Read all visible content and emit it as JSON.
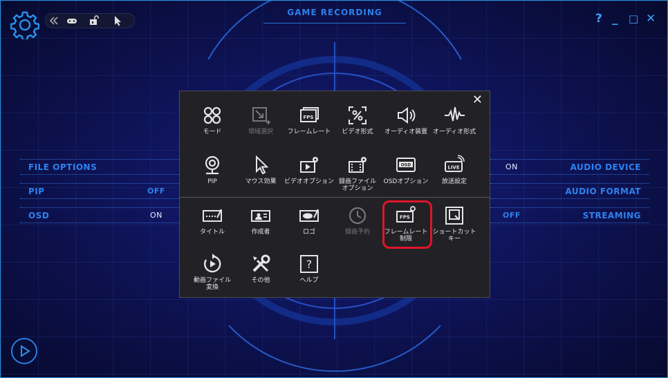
{
  "window": {
    "title": "GAME RECORDING",
    "help": "?",
    "minimize": "_",
    "maximize": "□",
    "close": "✕"
  },
  "left_panel": {
    "rows": [
      {
        "label": "FILE OPTIONS",
        "value": ""
      },
      {
        "label": "PIP",
        "value": "OFF"
      },
      {
        "label": "OSD",
        "value": "ON"
      }
    ]
  },
  "right_panel": {
    "rows": [
      {
        "label": "AUDIO DEVICE",
        "value": "ON"
      },
      {
        "label": "AUDIO FORMAT",
        "value": ""
      },
      {
        "label": "STREAMING",
        "value": "OFF"
      }
    ]
  },
  "menu": {
    "close": "✕",
    "items": [
      {
        "label": "モード",
        "icon": "mode-icon",
        "enabled": true
      },
      {
        "label": "領域選択",
        "icon": "area-select-icon",
        "enabled": false
      },
      {
        "label": "フレームレート",
        "icon": "fps-icon",
        "enabled": true
      },
      {
        "label": "ビデオ形式",
        "icon": "video-format-icon",
        "enabled": true
      },
      {
        "label": "オーディオ装置",
        "icon": "speaker-icon",
        "enabled": true
      },
      {
        "label": "オーディオ形式",
        "icon": "waveform-icon",
        "enabled": true
      },
      {
        "label": "PIP",
        "icon": "webcam-icon",
        "enabled": true
      },
      {
        "label": "マウス効果",
        "icon": "cursor-icon",
        "enabled": true
      },
      {
        "label": "ビデオオプション",
        "icon": "video-options-icon",
        "enabled": true
      },
      {
        "label": "録画ファイル\nオプション",
        "icon": "file-options-icon",
        "enabled": true
      },
      {
        "label": "OSDオプション",
        "icon": "osd-icon",
        "enabled": true
      },
      {
        "label": "放送設定",
        "icon": "live-icon",
        "enabled": true
      },
      {
        "label": "タイトル",
        "icon": "title-icon",
        "enabled": true
      },
      {
        "label": "作成者",
        "icon": "author-icon",
        "enabled": true
      },
      {
        "label": "ロゴ",
        "icon": "logo-icon",
        "enabled": true
      },
      {
        "label": "録画予約",
        "icon": "clock-icon",
        "enabled": false
      },
      {
        "label": "フレームレート\n制限",
        "icon": "fps-limit-icon",
        "enabled": true,
        "highlighted": true
      },
      {
        "label": "ショートカット\nキー",
        "icon": "shortcut-icon",
        "enabled": true
      },
      {
        "label": "動画ファイル\n変換",
        "icon": "convert-icon",
        "enabled": true
      },
      {
        "label": "その他",
        "icon": "tools-icon",
        "enabled": true
      },
      {
        "label": "ヘルプ",
        "icon": "help-icon",
        "enabled": true
      }
    ]
  },
  "colors": {
    "accent": "#2e82f0",
    "highlight": "#e0142a",
    "menu_bg": "#222226"
  }
}
